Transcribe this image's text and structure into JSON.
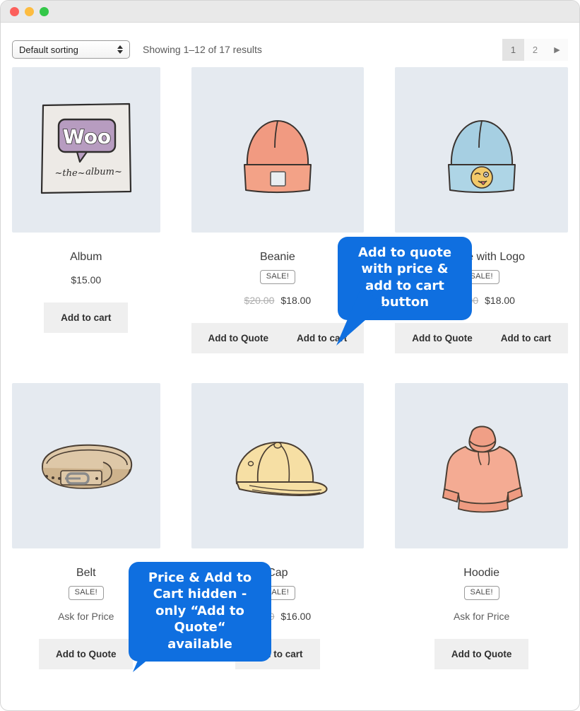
{
  "window": {
    "traffic_lights": [
      "close",
      "minimize",
      "maximize"
    ]
  },
  "toolbar": {
    "sort_selected": "Default sorting",
    "sort_options": [
      "Default sorting"
    ],
    "result_count": "Showing 1–12 of 17 results",
    "pagination": {
      "pages": [
        "1",
        "2"
      ],
      "current": "1",
      "next_label": "▶"
    }
  },
  "products": [
    {
      "name": "Album",
      "image": "album-cover-illustration",
      "on_sale": false,
      "sale_label": "",
      "price_old": "",
      "price": "$15.00",
      "buttons": [
        "Add to cart"
      ]
    },
    {
      "name": "Beanie",
      "image": "orange-beanie-illustration",
      "on_sale": true,
      "sale_label": "SALE!",
      "price_old": "$20.00",
      "price": "$18.00",
      "buttons": [
        "Add to Quote",
        "Add to cart"
      ]
    },
    {
      "name": "Beanie with Logo",
      "image": "blue-beanie-with-emoji-logo-illustration",
      "on_sale": true,
      "sale_label": "SALE!",
      "price_old": "$20.00",
      "price": "$18.00",
      "buttons": [
        "Add to Quote",
        "Add to cart"
      ]
    },
    {
      "name": "Belt",
      "image": "leather-belt-illustration",
      "on_sale": true,
      "sale_label": "SALE!",
      "price_old": "",
      "price": "Ask for Price",
      "buttons": [
        "Add to Quote"
      ]
    },
    {
      "name": "Cap",
      "image": "yellow-baseball-cap-illustration",
      "on_sale": true,
      "sale_label": "SALE!",
      "price_old": "$18.00",
      "price": "$16.00",
      "buttons": [
        "Add to cart"
      ]
    },
    {
      "name": "Hoodie",
      "image": "pink-hoodie-illustration",
      "on_sale": true,
      "sale_label": "SALE!",
      "price_old": "",
      "price": "Ask for Price",
      "buttons": [
        "Add to Quote"
      ]
    }
  ],
  "callouts": [
    {
      "id": "callout-1",
      "text": "Add to quote with price & add to cart button",
      "color": "#0f6fe0",
      "points_to": "beanie-button-row"
    },
    {
      "id": "callout-2",
      "text": "Price & Add to Cart hidden - only “Add to Quote“ available",
      "color": "#0f6fe0",
      "points_to": "belt-price"
    }
  ]
}
